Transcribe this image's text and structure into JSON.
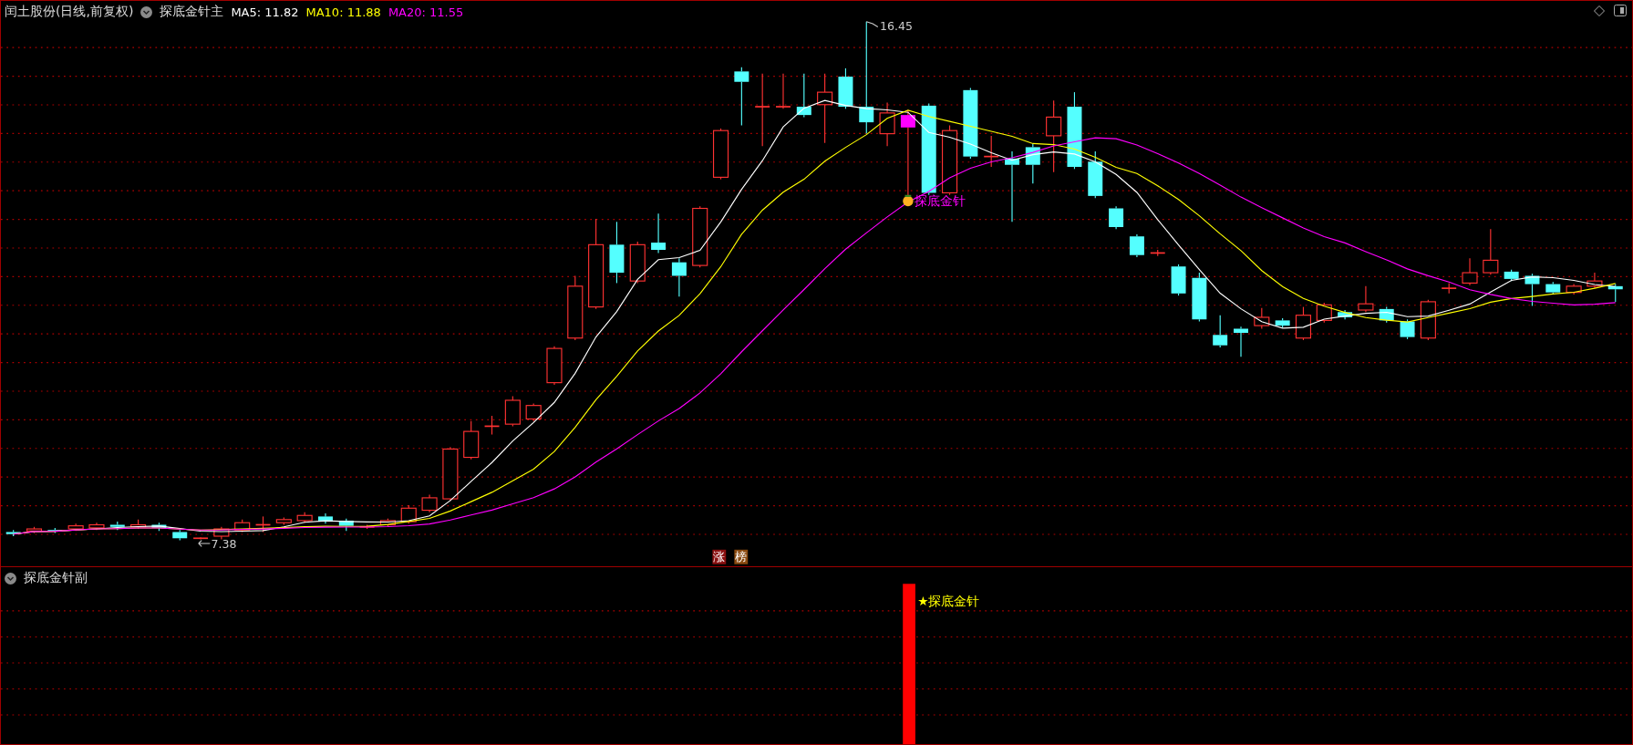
{
  "main_panel": {
    "stock_title": "闰土股份(日线,前复权)",
    "indicator": "探底金针主",
    "ma_readings": [
      {
        "label": "MA5: 11.82",
        "color": "#ffffff"
      },
      {
        "label": "MA10: 11.88",
        "color": "#ffff00"
      },
      {
        "label": "MA20: 11.55",
        "color": "#ff00ff"
      }
    ],
    "high_label": "16.45",
    "low_label": "7.38",
    "signal_label": "探底金针",
    "badges": [
      "涨",
      "榜"
    ]
  },
  "sub_panel": {
    "indicator": "探底金针副",
    "signal_label": "★探底金针"
  }
}
